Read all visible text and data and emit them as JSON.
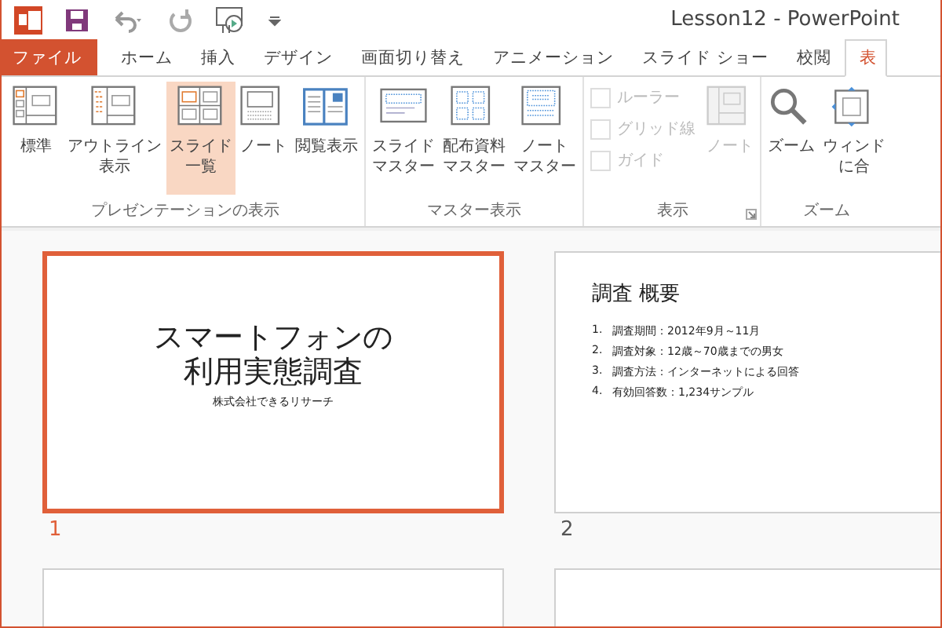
{
  "window": {
    "title": "Lesson12 - PowerPoint"
  },
  "tabs": [
    {
      "label": "ファイル",
      "kind": "file",
      "selected": false
    },
    {
      "label": "ホーム",
      "kind": "tab",
      "selected": false
    },
    {
      "label": "挿入",
      "kind": "tab",
      "selected": false
    },
    {
      "label": "デザイン",
      "kind": "tab",
      "selected": false
    },
    {
      "label": "画面切り替え",
      "kind": "tab",
      "selected": false
    },
    {
      "label": "アニメーション",
      "kind": "tab",
      "selected": false
    },
    {
      "label": "スライド ショー",
      "kind": "tab",
      "selected": false
    },
    {
      "label": "校閲",
      "kind": "tab",
      "selected": false
    },
    {
      "label": "表",
      "kind": "tab",
      "selected": true
    }
  ],
  "ribbon": {
    "groups": [
      {
        "label": "プレゼンテーションの表示",
        "dialog_launcher": false,
        "items": [
          {
            "kind": "large",
            "lines": [
              "標準"
            ],
            "selected": false,
            "disabled": false
          },
          {
            "kind": "large",
            "lines": [
              "アウトライン",
              "表示"
            ],
            "selected": false,
            "disabled": false
          },
          {
            "kind": "large",
            "lines": [
              "スライド",
              "一覧"
            ],
            "selected": true,
            "disabled": false
          },
          {
            "kind": "large",
            "lines": [
              "ノート"
            ],
            "selected": false,
            "disabled": false
          },
          {
            "kind": "large",
            "lines": [
              "閲覧表示"
            ],
            "selected": false,
            "disabled": false
          }
        ]
      },
      {
        "label": "マスター表示",
        "dialog_launcher": false,
        "items": [
          {
            "kind": "large",
            "lines": [
              "スライド",
              "マスター"
            ],
            "selected": false,
            "disabled": false
          },
          {
            "kind": "large",
            "lines": [
              "配布資料",
              "マスター"
            ],
            "selected": false,
            "disabled": false
          },
          {
            "kind": "large",
            "lines": [
              "ノート",
              "マスター"
            ],
            "selected": false,
            "disabled": false
          }
        ]
      },
      {
        "label": "表示",
        "dialog_launcher": true,
        "items": [
          {
            "kind": "checks",
            "checks": [
              {
                "label": "ルーラー",
                "checked": false,
                "disabled": true
              },
              {
                "label": "グリッド線",
                "checked": false,
                "disabled": true
              },
              {
                "label": "ガイド",
                "checked": false,
                "disabled": true
              }
            ]
          },
          {
            "kind": "large",
            "lines": [
              "ノート"
            ],
            "selected": false,
            "disabled": true
          }
        ]
      },
      {
        "label": "ズーム",
        "dialog_launcher": false,
        "items": [
          {
            "kind": "large",
            "lines": [
              "ズーム"
            ],
            "selected": false,
            "disabled": false
          },
          {
            "kind": "large",
            "lines": [
              "ウィンド",
              "に合"
            ],
            "selected": false,
            "disabled": false
          }
        ]
      }
    ]
  },
  "slides": [
    {
      "kind": "title",
      "number": "1",
      "selected": true,
      "title_lines": [
        "スマートフォンの",
        "利用実態調査"
      ],
      "subtitle": "株式会社できるリサーチ"
    },
    {
      "kind": "list",
      "number": "2",
      "selected": false,
      "title": "調査 概要",
      "items": [
        {
          "marker": "1.",
          "text": "調査期間：2012年9月～11月"
        },
        {
          "marker": "2.",
          "text": "調査対象：12歳～70歳までの男女"
        },
        {
          "marker": "3.",
          "text": "調査方法：インターネットによる回答"
        },
        {
          "marker": "4.",
          "text": "有効回答数：1,234サンプル"
        }
      ]
    },
    {
      "kind": "blank",
      "selected": false
    },
    {
      "kind": "blank",
      "selected": false
    }
  ]
}
